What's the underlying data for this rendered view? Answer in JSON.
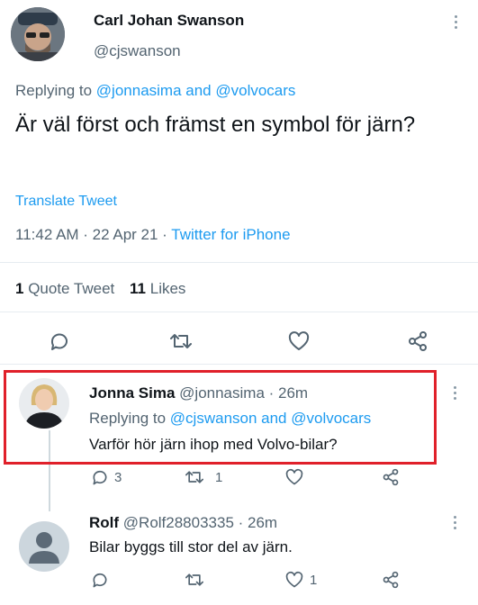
{
  "main_tweet": {
    "author_name": "Carl Johan Swanson",
    "author_handle": "@cjswanson",
    "replying_prefix": "Replying to",
    "replying_to": "@jonnasima and @volvocars",
    "text": "Är väl först och främst en symbol för järn?",
    "translate_label": "Translate Tweet",
    "timestamp": "11:42 AM · 22 Apr 21 · ",
    "source": "Twitter for iPhone",
    "quote_count": "1",
    "quote_label": "Quote Tweet",
    "likes_count": "11",
    "likes_label": "Likes"
  },
  "replies": [
    {
      "author_name": "Jonna Sima",
      "author_handle": "@jonnasima · 26m",
      "replying_prefix": "Replying to",
      "replying_to": "@cjswanson and @volvocars",
      "text": "Varför hör järn ihop med Volvo-bilar?",
      "reply_count": "3",
      "retweet_count": "1",
      "like_count": ""
    },
    {
      "author_name": "Rolf",
      "author_handle": "@Rolf28803335 · 26m",
      "text": "Bilar byggs till stor del av järn.",
      "reply_count": "",
      "retweet_count": "",
      "like_count": "1"
    }
  ],
  "colors": {
    "accent": "#1d9bf0",
    "highlight_box": "#e0202a",
    "secondary_text": "#536471"
  }
}
